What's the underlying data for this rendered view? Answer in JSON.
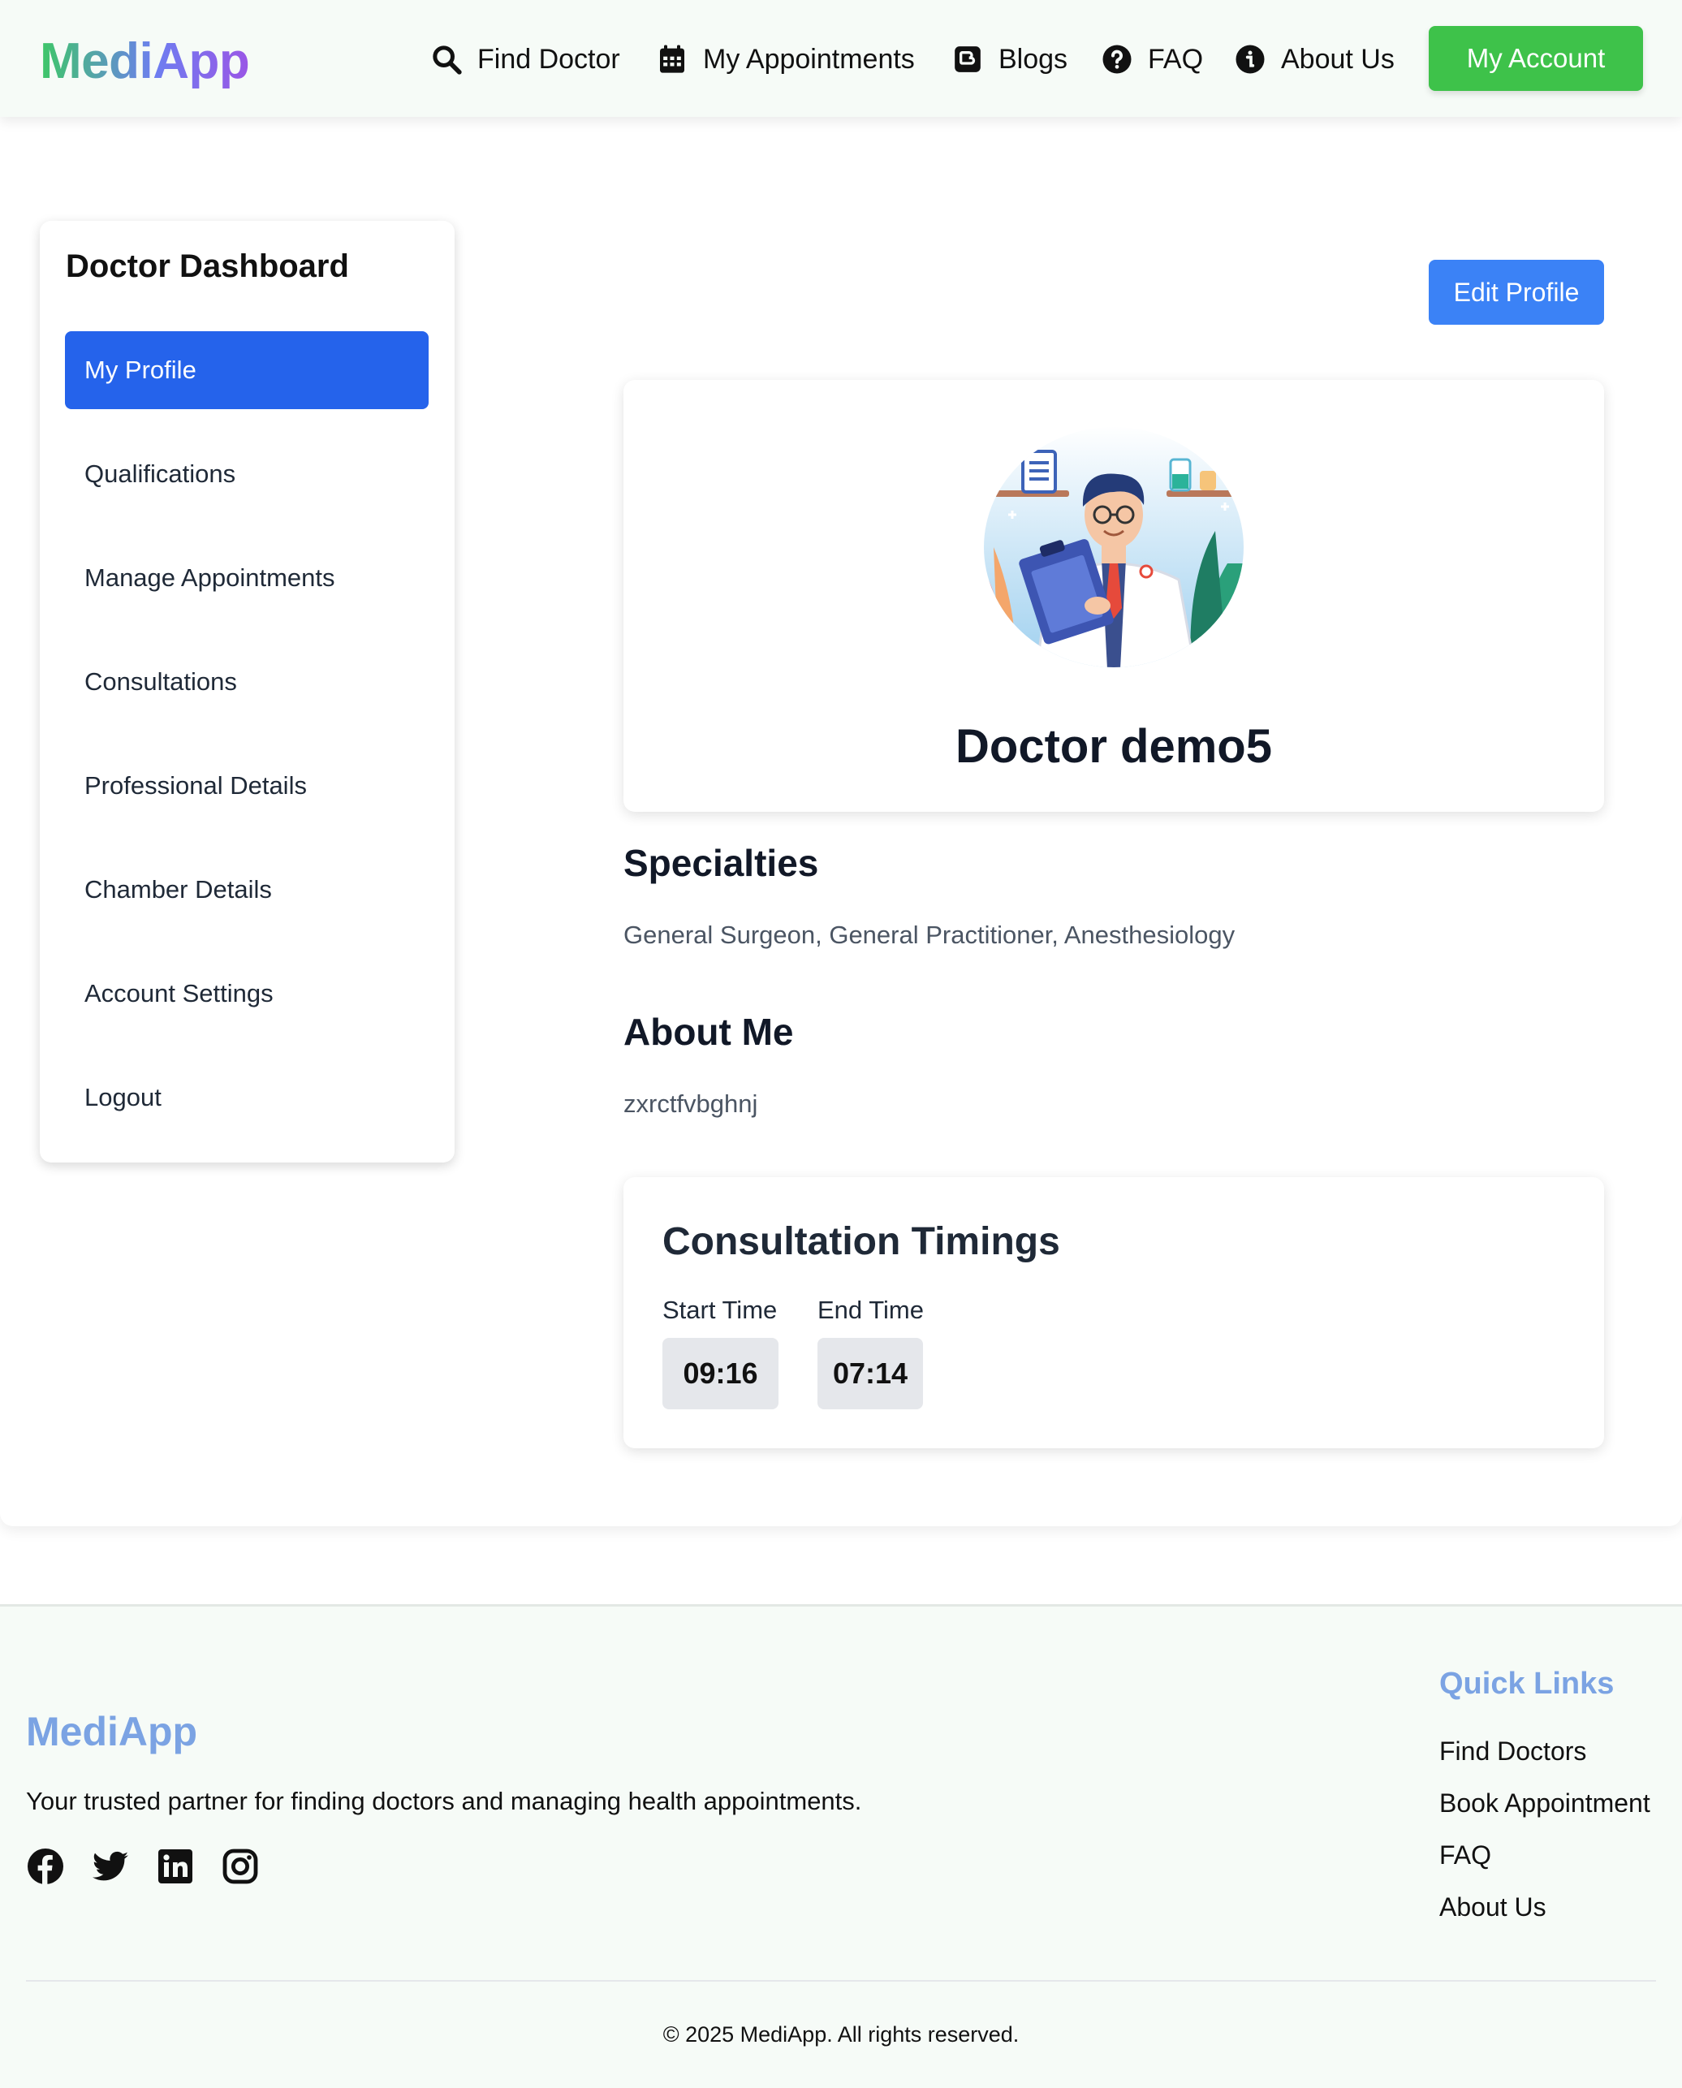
{
  "header": {
    "logo": "MediApp",
    "nav": [
      {
        "label": "Find Doctor",
        "icon": "search-icon"
      },
      {
        "label": "My Appointments",
        "icon": "calendar-icon"
      },
      {
        "label": "Blogs",
        "icon": "blogger-icon"
      },
      {
        "label": "FAQ",
        "icon": "question-circle-icon"
      },
      {
        "label": "About Us",
        "icon": "info-circle-icon"
      }
    ],
    "account_button": "My Account"
  },
  "sidebar": {
    "title": "Doctor Dashboard",
    "items": [
      {
        "label": "My Profile",
        "active": true
      },
      {
        "label": "Qualifications"
      },
      {
        "label": "Manage Appointments"
      },
      {
        "label": "Consultations"
      },
      {
        "label": "Professional Details"
      },
      {
        "label": "Chamber Details"
      },
      {
        "label": "Account Settings"
      },
      {
        "label": "Logout"
      }
    ]
  },
  "profile": {
    "edit_button": "Edit Profile",
    "name": "Doctor demo5",
    "specialties_title": "Specialties",
    "specialties": "General Surgeon, General Practitioner, Anesthesiology",
    "about_title": "About Me",
    "about": "zxrctfvbghnj"
  },
  "timings": {
    "title": "Consultation Timings",
    "start_label": "Start Time",
    "start_value": "09:16",
    "end_label": "End Time",
    "end_value": "07:14"
  },
  "footer": {
    "logo": "MediApp",
    "tagline": "Your trusted partner for finding doctors and managing health appointments.",
    "socials": [
      "facebook-icon",
      "twitter-icon",
      "linkedin-icon",
      "instagram-icon"
    ],
    "quick_links_title": "Quick Links",
    "quick_links": [
      "Find Doctors",
      "Book Appointment",
      "FAQ",
      "About Us"
    ],
    "copyright": "© 2025 MediApp. All rights reserved."
  },
  "colors": {
    "accent_green": "#3ec24a",
    "accent_blue": "#2563eb",
    "edit_blue": "#3b82f6",
    "footer_brand": "#7ba3e3"
  }
}
